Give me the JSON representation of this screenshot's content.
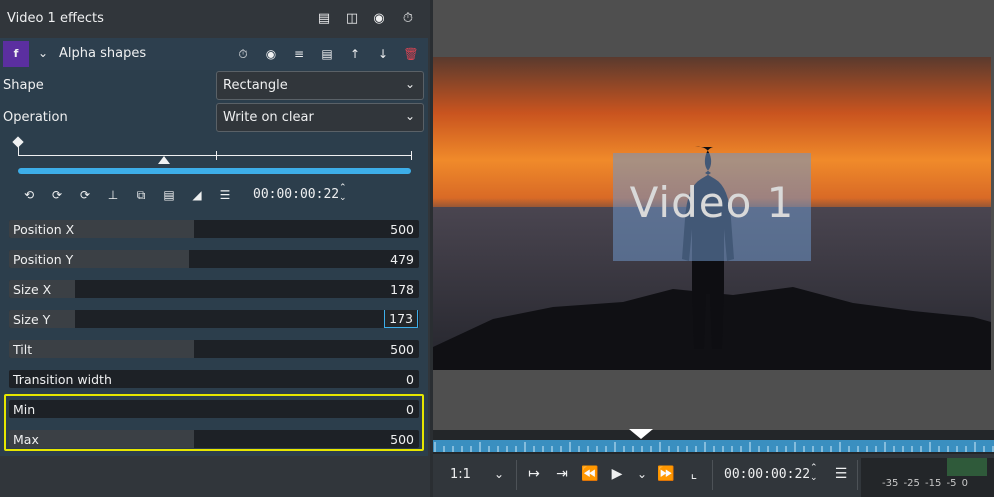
{
  "effects_panel": {
    "title": "Video 1 effects",
    "header_icons": [
      "save-stack-icon",
      "split-compare-icon",
      "eye-icon",
      "timer-icon"
    ],
    "effect": {
      "badge": "f",
      "name": "Alpha shapes",
      "row_icons": [
        "timer-icon",
        "eye-icon",
        "sliders-icon",
        "save-icon",
        "move-up-icon",
        "move-down-icon",
        "delete-icon"
      ],
      "shape_label": "Shape",
      "shape_value": "Rectangle",
      "operation_label": "Operation",
      "operation_value": "Write on clear",
      "keyframe_time": "00:00:00:22",
      "params": [
        {
          "label": "Position X",
          "value": "500",
          "fill": 0.45
        },
        {
          "label": "Position Y",
          "value": "479",
          "fill": 0.44
        },
        {
          "label": "Size X",
          "value": "178",
          "fill": 0.16
        },
        {
          "label": "Size Y",
          "value": "173",
          "fill": 0.16,
          "editing": true
        },
        {
          "label": "Tilt",
          "value": "500",
          "fill": 0.45
        },
        {
          "label": "Transition width",
          "value": "0",
          "fill": 0.0
        },
        {
          "label": "Min",
          "value": "0",
          "fill": 0.0
        },
        {
          "label": "Max",
          "value": "500",
          "fill": 0.45
        }
      ]
    }
  },
  "monitor": {
    "overlay_title": "Video 1",
    "zoom": "1:1",
    "timecode": "00:00:00:22",
    "meter_labels": "-35 -25 -15 -5 0",
    "colors": {
      "accent": "#3daee9",
      "highlight": "#e6e600"
    }
  }
}
